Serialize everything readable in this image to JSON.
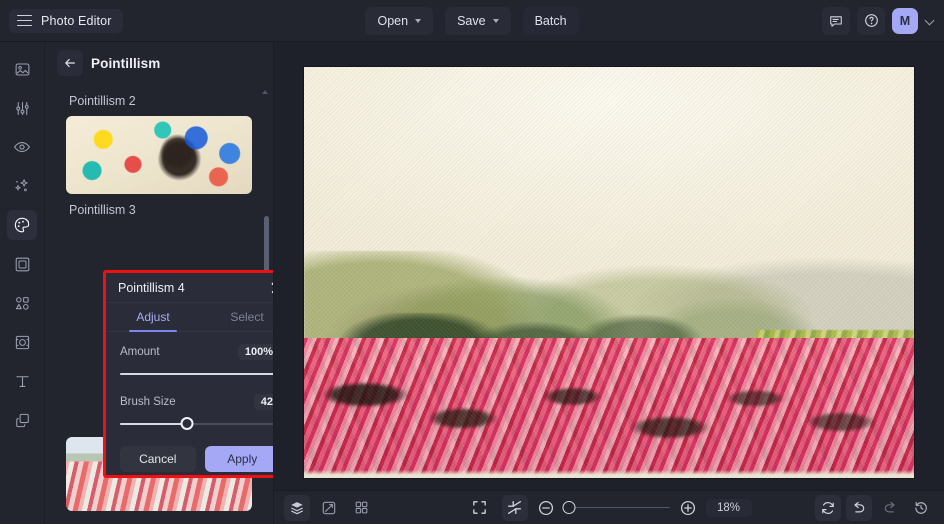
{
  "app": {
    "title": "Photo Editor",
    "accent": "#a5a9f5",
    "annotation_color": "#ee1111",
    "bg": "#22242e"
  },
  "topbar": {
    "menu_icon": "hamburger-icon",
    "open_label": "Open",
    "save_label": "Save",
    "batch_label": "Batch",
    "comment_icon": "comment-icon",
    "help_icon": "help-circle-icon",
    "avatar_initial": "M",
    "account_chevron": "chevron-down-icon"
  },
  "rail": {
    "items": [
      {
        "name": "image-icon",
        "label": "Image",
        "active": false
      },
      {
        "name": "adjust-icon",
        "label": "Adjust",
        "active": false
      },
      {
        "name": "eye-icon",
        "label": "Preview",
        "active": false
      },
      {
        "name": "sparkles-icon",
        "label": "Enhance",
        "active": false
      },
      {
        "name": "palette-icon",
        "label": "Effects",
        "active": true
      },
      {
        "name": "frame-icon",
        "label": "Frame",
        "active": false
      },
      {
        "name": "shapes-icon",
        "label": "Shapes",
        "active": false
      },
      {
        "name": "transform-icon",
        "label": "Transform",
        "active": false
      },
      {
        "name": "text-icon",
        "label": "Text",
        "active": false
      },
      {
        "name": "layers-icon",
        "label": "Layers",
        "active": false
      }
    ]
  },
  "panel": {
    "back_icon": "arrow-left-icon",
    "title": "Pointillism",
    "presets": [
      {
        "label": "Pointillism 2",
        "position": "above-thumb"
      },
      {
        "label": "Pointillism 3",
        "position": "below-thumb"
      }
    ],
    "scroll_up_icon": "caret-up-icon"
  },
  "popover": {
    "title": "Pointillism 4",
    "close_icon": "close-icon",
    "tabs": [
      {
        "label": "Adjust",
        "active": true
      },
      {
        "label": "Select",
        "active": false
      }
    ],
    "controls": [
      {
        "label": "Amount",
        "value": "100%",
        "percent": 100
      },
      {
        "label": "Brush Size",
        "value": "42",
        "percent": 42
      }
    ],
    "cancel_label": "Cancel",
    "apply_label": "Apply"
  },
  "bottombar": {
    "left_tools": [
      {
        "name": "layers-stack-icon",
        "label": "Layers",
        "selected": true
      },
      {
        "name": "compare-icon",
        "label": "Compare",
        "selected": false
      },
      {
        "name": "grid-icon",
        "label": "Grid",
        "selected": false
      }
    ],
    "view_tools": [
      {
        "name": "fit-screen-icon",
        "label": "Fit to screen",
        "selected": false
      },
      {
        "name": "collapse-icon",
        "label": "Collapse",
        "selected": true
      }
    ],
    "zoom_out_icon": "zoom-out-icon",
    "zoom_in_icon": "zoom-in-icon",
    "zoom_value": "18%",
    "zoom_percent": 5,
    "right_tools": [
      {
        "name": "reset-icon",
        "label": "Reset",
        "selected": true,
        "dimmed": false
      },
      {
        "name": "undo-icon",
        "label": "Undo",
        "selected": true,
        "dimmed": false
      },
      {
        "name": "redo-icon",
        "label": "Redo",
        "selected": false,
        "dimmed": true
      },
      {
        "name": "history-icon",
        "label": "History",
        "selected": false,
        "dimmed": false
      }
    ]
  },
  "canvas": {
    "artwork_alt": "Pointillist landscape with pale sky, rolling hills and a pink flower field"
  }
}
